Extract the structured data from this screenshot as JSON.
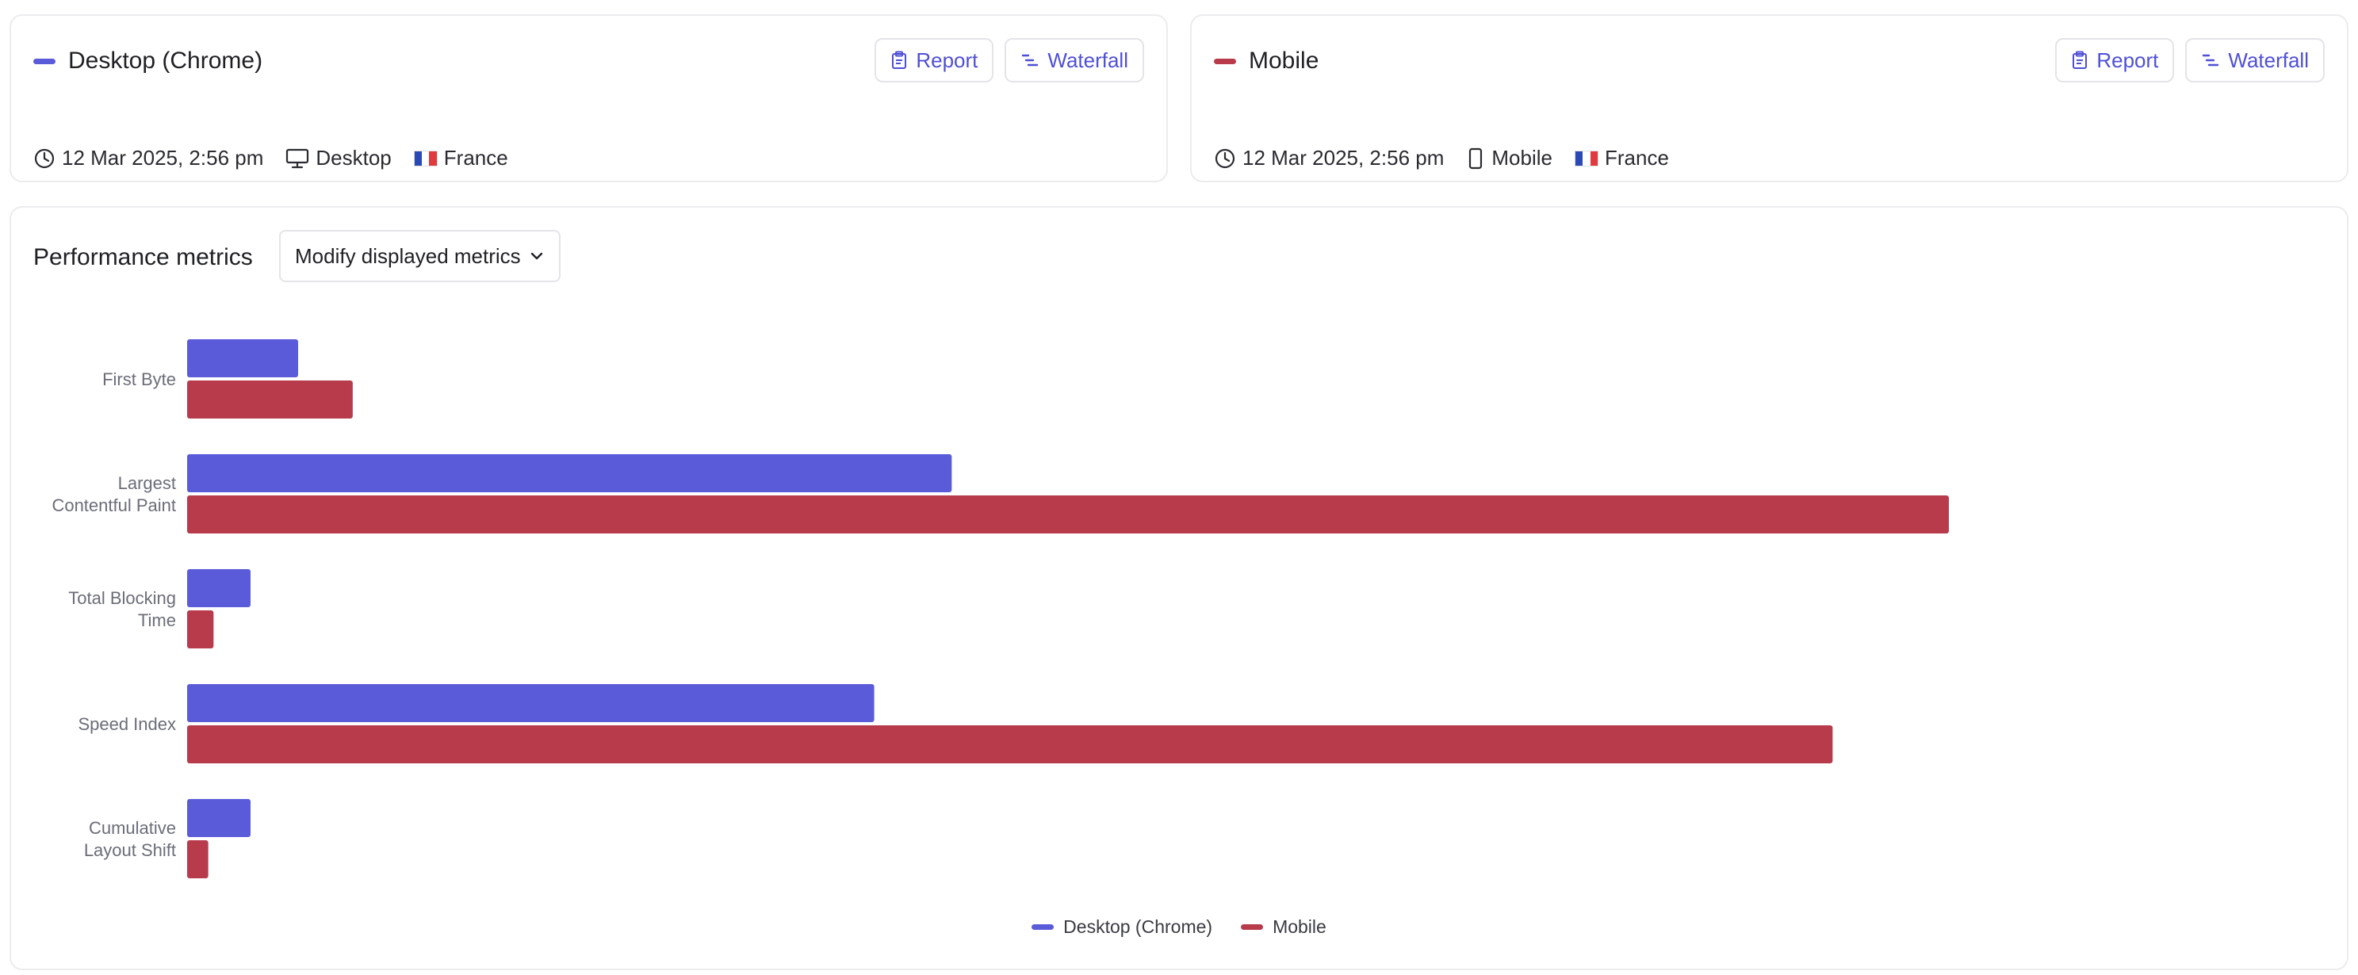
{
  "colors": {
    "desktop": "#5a5bd8",
    "mobile": "#b73b4b",
    "accent": "#4f4fd6"
  },
  "tests": [
    {
      "name": "Desktop (Chrome)",
      "report_label": "Report",
      "waterfall_label": "Waterfall",
      "timestamp": "12 Mar 2025, 2:56 pm",
      "device": "Desktop",
      "device_icon": "monitor-icon",
      "location": "France"
    },
    {
      "name": "Mobile",
      "report_label": "Report",
      "waterfall_label": "Waterfall",
      "timestamp": "12 Mar 2025, 2:56 pm",
      "device": "Mobile",
      "device_icon": "smartphone-icon",
      "location": "France"
    }
  ],
  "metrics": {
    "title": "Performance metrics",
    "dropdown_label": "Modify displayed metrics"
  },
  "chart_data": {
    "type": "bar",
    "orientation": "horizontal",
    "categories": [
      [
        "First Byte"
      ],
      [
        "Largest",
        "Contentful Paint"
      ],
      [
        "Total Blocking",
        "Time"
      ],
      [
        "Speed Index"
      ],
      [
        "Cumulative",
        "Layout Shift"
      ]
    ],
    "series": [
      {
        "name": "Desktop (Chrome)",
        "values": [
          0.063,
          0.434,
          0.036,
          0.39,
          0.036
        ]
      },
      {
        "name": "Mobile",
        "values": [
          0.094,
          1.0,
          0.015,
          0.934,
          0.012
        ]
      }
    ],
    "value_scale": "relative to largest bar (no value axis printed)",
    "xlim": [
      0,
      1
    ],
    "grid": false,
    "legend_position": "bottom-center"
  }
}
